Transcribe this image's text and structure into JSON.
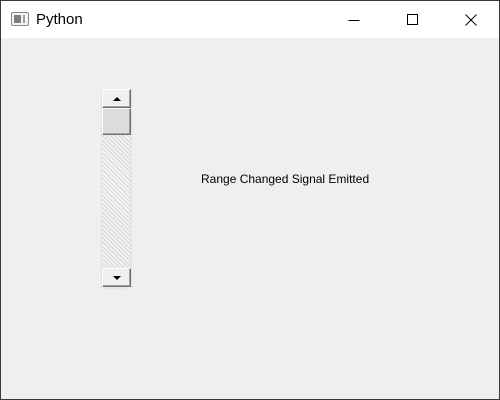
{
  "window": {
    "title": "Python"
  },
  "title_bar_buttons": {
    "minimize_icon": "minimize-icon",
    "maximize_icon": "maximize-icon",
    "close_icon": "close-icon"
  },
  "scrollbar": {
    "orientation": "vertical",
    "value_fraction": 0.0,
    "up_icon": "arrow-up-icon",
    "down_icon": "arrow-down-icon"
  },
  "status_label": {
    "text": "Range Changed Signal Emitted"
  },
  "colors": {
    "titlebar": "#ffffff",
    "client_background": "#efefef",
    "window_border": "#3a3a3a"
  }
}
